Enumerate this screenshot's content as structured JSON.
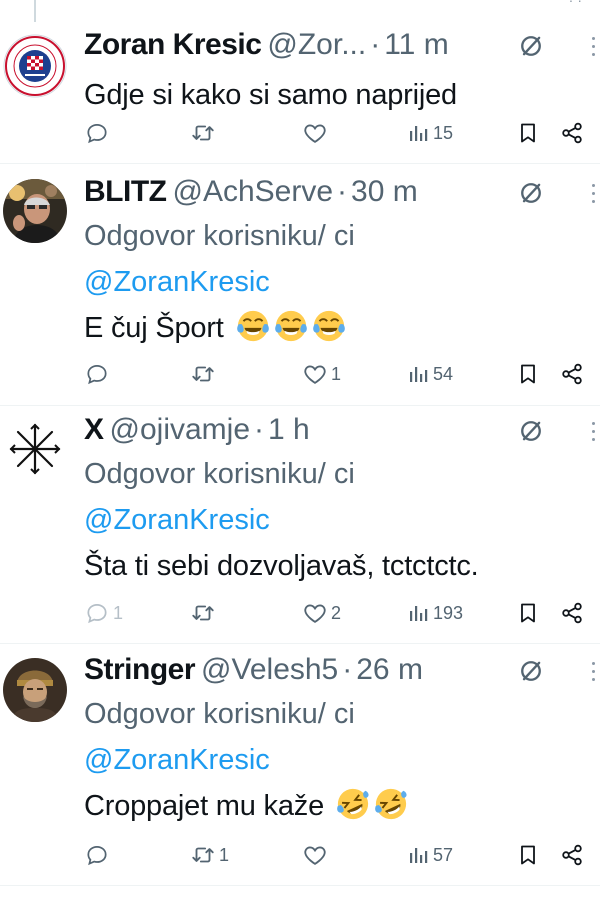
{
  "tweets": [
    {
      "name": "Zoran Kresic",
      "handle": "@Zor...",
      "time": "11 m",
      "reply_prefix": "",
      "reply_mention": "",
      "text": "Gdje si kako si samo naprijed",
      "emoji": [],
      "replies": "",
      "retweets": "",
      "likes": "",
      "views": "15",
      "avatar": "club-crest"
    },
    {
      "name": "BLITZ",
      "handle": "@AchServe",
      "time": "30 m",
      "reply_prefix": "Odgovor korisniku/ ci",
      "reply_mention": "@ZoranKresic",
      "text": "E čuj Šport",
      "emoji": [
        "face-with-tears-of-joy",
        "face-with-tears-of-joy",
        "face-with-tears-of-joy"
      ],
      "replies": "",
      "retweets": "",
      "likes": "1",
      "views": "54",
      "avatar": "person-photo"
    },
    {
      "name": "X",
      "handle": "@ojivamje",
      "time": "1 h",
      "reply_prefix": "Odgovor korisniku/ ci",
      "reply_mention": "@ZoranKresic",
      "text": "Šta ti sebi dozvoljavaš, tctctctc.",
      "emoji": [],
      "replies": "1",
      "retweets": "",
      "likes": "2",
      "views": "193",
      "avatar": "asterisk-symbol"
    },
    {
      "name": "Stringer",
      "handle": "@Velesh5",
      "time": "26 m",
      "reply_prefix": "Odgovor korisniku/ ci",
      "reply_mention": "@ZoranKresic",
      "text": "Croppajet mu kaže",
      "emoji": [
        "rolling-on-the-floor-laughing",
        "rolling-on-the-floor-laughing"
      ],
      "replies": "",
      "retweets": "1",
      "likes": "",
      "views": "57",
      "avatar": "bearded-man-photo"
    }
  ],
  "colors": {
    "text": "#0f1419",
    "secondary": "#536471",
    "link": "#1d9bf0",
    "divider": "#eff3f4"
  }
}
